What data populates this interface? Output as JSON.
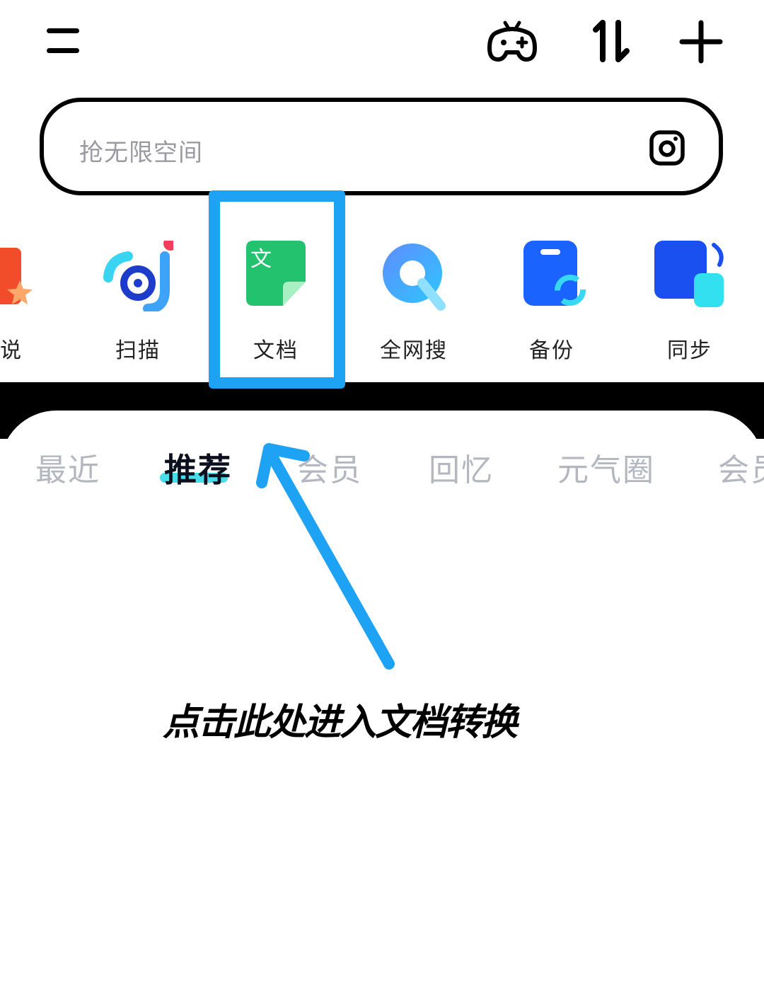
{
  "search": {
    "placeholder": "抢无限空间"
  },
  "apps": [
    {
      "label": "说"
    },
    {
      "label": "扫描"
    },
    {
      "label": "文档",
      "icon_text": "文"
    },
    {
      "label": "全网搜"
    },
    {
      "label": "备份"
    },
    {
      "label": "同步"
    }
  ],
  "tabs": [
    "最近",
    "推荐",
    "会员",
    "回忆",
    "元气圈",
    "会员"
  ],
  "active_tab": "推荐",
  "caption": "点击此处进入文档转换",
  "colors": {
    "highlight": "#1ea3f4",
    "tab_underline": "#24d8e6",
    "doc_green": "#22c26f",
    "blue": "#1a63ff"
  },
  "icons": {
    "menu": "menu-icon",
    "game": "gamepad-icon",
    "transfer": "transfer-icon",
    "add": "plus-icon",
    "camera": "camera-scan-icon"
  }
}
